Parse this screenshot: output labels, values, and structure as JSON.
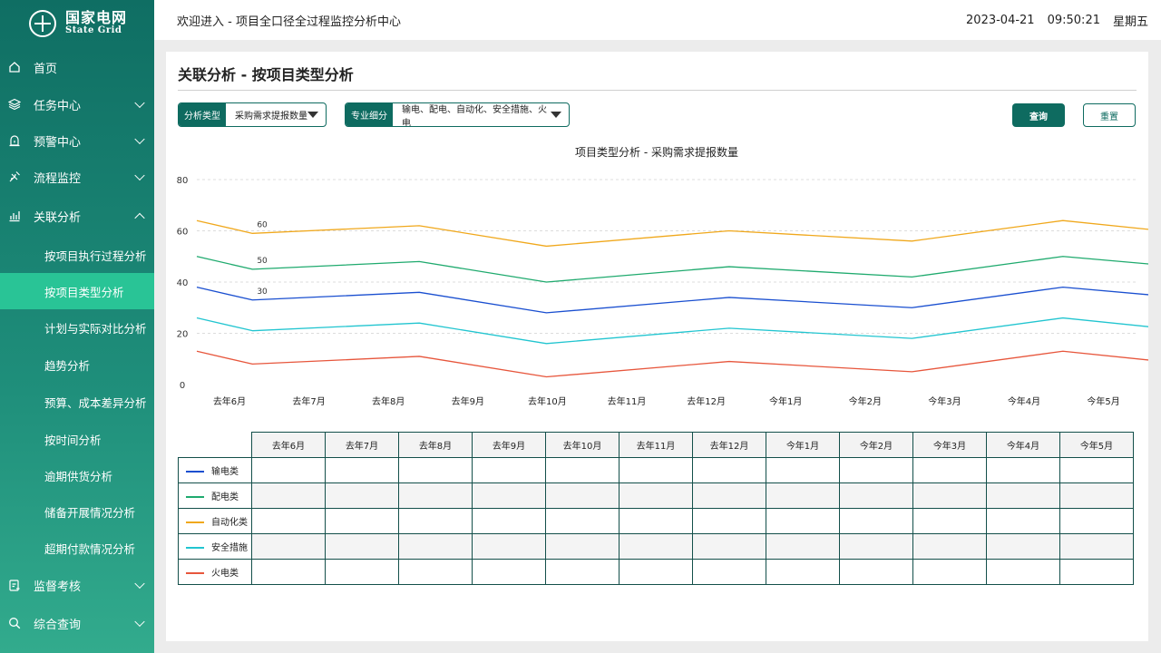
{
  "brand": {
    "cn": "国家电网",
    "en": "State Grid"
  },
  "header": {
    "welcome": "欢迎进入 - 项目全口径全过程监控分析中心",
    "date": "2023-04-21",
    "time": "09:50:21",
    "weekday": "星期五"
  },
  "sidebar": {
    "items": [
      {
        "label": "首页",
        "icon": "home-icon"
      },
      {
        "label": "任务中心",
        "icon": "layers-icon"
      },
      {
        "label": "预警中心",
        "icon": "alert-icon"
      },
      {
        "label": "流程监控",
        "icon": "satellite-icon"
      },
      {
        "label": "关联分析",
        "icon": "bar-chart-icon"
      }
    ],
    "sub_items": [
      "按项目执行过程分析",
      "按项目类型分析",
      "计划与实际对比分析",
      "趋势分析",
      "预算、成本差异分析",
      "按时间分析",
      "逾期供货分析",
      "储备开展情况分析",
      "超期付款情况分析"
    ],
    "active_sub": "按项目类型分析",
    "bottom_items": [
      {
        "label": "监督考核",
        "icon": "clipboard-icon"
      },
      {
        "label": "综合查询",
        "icon": "search-icon"
      }
    ]
  },
  "page": {
    "title": "关联分析 - 按项目类型分析"
  },
  "filters": {
    "type": {
      "label": "分析类型",
      "value": "采购需求提报数量"
    },
    "category": {
      "label": "专业细分",
      "value": "输电、配电、自动化、安全措施、火电"
    }
  },
  "buttons": {
    "query": "查询",
    "reset": "重置"
  },
  "colors": {
    "accent": "#0e6b60",
    "active": "#29c496"
  },
  "chart_data": {
    "type": "line",
    "title": "项目类型分析 - 采购需求提报数量",
    "categories": [
      "去年6月",
      "去年7月",
      "去年8月",
      "去年9月",
      "去年10月",
      "去年11月",
      "去年12月",
      "今年1月",
      "今年2月",
      "今年3月",
      "今年4月",
      "今年5月"
    ],
    "yticks": [
      0,
      20,
      40,
      60,
      80
    ],
    "ylim": [
      0,
      80
    ],
    "grid": true,
    "series": [
      {
        "name": "输电类",
        "color": "#1a4fd0",
        "points": [
          [
            0,
            38
          ],
          [
            0.7,
            33
          ],
          [
            2.8,
            36
          ],
          [
            4.4,
            28
          ],
          [
            6.7,
            34
          ],
          [
            9.0,
            30
          ],
          [
            10.9,
            38
          ],
          [
            12.0,
            35
          ]
        ]
      },
      {
        "name": "配电类",
        "color": "#1faa6e",
        "points": [
          [
            0,
            50
          ],
          [
            0.7,
            45
          ],
          [
            2.8,
            48
          ],
          [
            4.4,
            40
          ],
          [
            6.7,
            46
          ],
          [
            9.0,
            42
          ],
          [
            10.9,
            50
          ],
          [
            12.0,
            47
          ]
        ]
      },
      {
        "name": "自动化类",
        "color": "#f0a81c",
        "points": [
          [
            0,
            64
          ],
          [
            0.7,
            59
          ],
          [
            2.8,
            62
          ],
          [
            4.4,
            54
          ],
          [
            6.7,
            60
          ],
          [
            9.0,
            56
          ],
          [
            10.9,
            64
          ],
          [
            12.0,
            60.5
          ]
        ]
      },
      {
        "name": "安全措施",
        "color": "#22c5d0",
        "points": [
          [
            0,
            26
          ],
          [
            0.7,
            21
          ],
          [
            2.8,
            24
          ],
          [
            4.4,
            16
          ],
          [
            6.7,
            22
          ],
          [
            9.0,
            18
          ],
          [
            10.9,
            26
          ],
          [
            12.0,
            22.5
          ]
        ]
      },
      {
        "name": "火电类",
        "color": "#e7563c",
        "points": [
          [
            0,
            13
          ],
          [
            0.7,
            8
          ],
          [
            2.8,
            11
          ],
          [
            4.4,
            3
          ],
          [
            6.7,
            9
          ],
          [
            9.0,
            5
          ],
          [
            10.9,
            13
          ],
          [
            12.0,
            9.5
          ]
        ]
      }
    ],
    "annotations": [
      {
        "x": 0.7,
        "y": 59,
        "text": "60"
      },
      {
        "x": 0.7,
        "y": 45,
        "text": "50"
      },
      {
        "x": 0.7,
        "y": 33,
        "text": "30"
      }
    ]
  },
  "table": {
    "columns": [
      "去年6月",
      "去年7月",
      "去年8月",
      "去年9月",
      "去年10月",
      "去年11月",
      "去年12月",
      "今年1月",
      "今年2月",
      "今年3月",
      "今年4月",
      "今年5月"
    ],
    "rows": [
      "输电类",
      "配电类",
      "自动化类",
      "安全措施",
      "火电类"
    ]
  }
}
